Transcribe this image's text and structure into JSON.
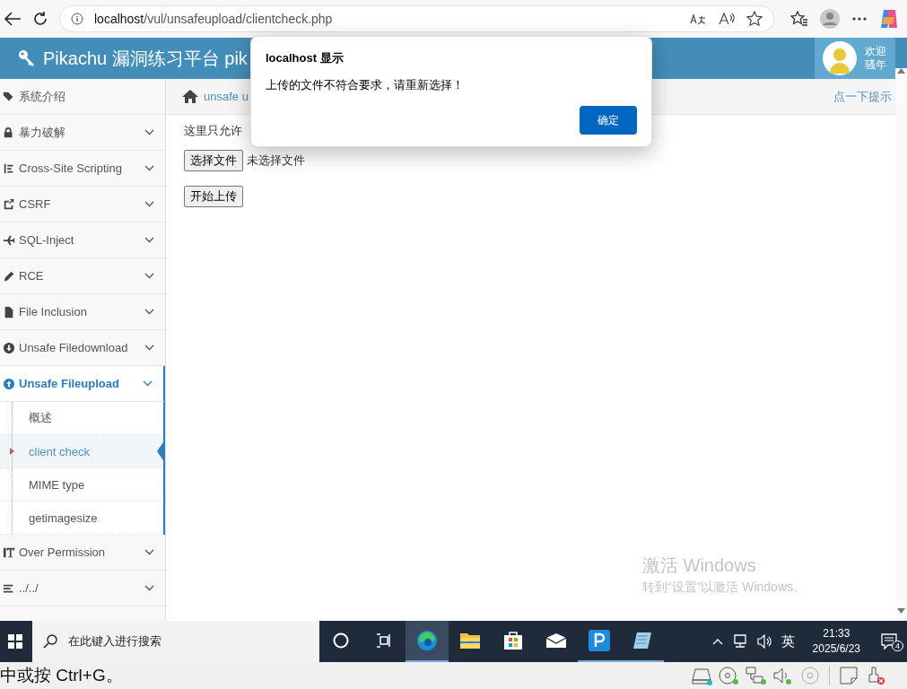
{
  "browser": {
    "url_host": "localhost",
    "url_path": "/vul/unsafeupload/clientcheck.php"
  },
  "header": {
    "title": "Pikachu 漏洞练习平台 pik",
    "welcome": [
      "欢迎",
      "骚年"
    ]
  },
  "sidebar": {
    "items": [
      {
        "label": "系统介绍",
        "kind": "link",
        "selected": false
      },
      {
        "label": "暴力破解",
        "kind": "menu",
        "selected": false,
        "expanded": false
      },
      {
        "label": "Cross-Site Scripting",
        "kind": "menu",
        "selected": false,
        "expanded": false
      },
      {
        "label": "CSRF",
        "kind": "menu",
        "selected": false,
        "expanded": false
      },
      {
        "label": "SQL-Inject",
        "kind": "menu",
        "selected": false,
        "expanded": false
      },
      {
        "label": "RCE",
        "kind": "menu",
        "selected": false,
        "expanded": false
      },
      {
        "label": "File Inclusion",
        "kind": "menu",
        "selected": false,
        "expanded": false
      },
      {
        "label": "Unsafe Filedownload",
        "kind": "menu",
        "selected": false,
        "expanded": false
      },
      {
        "label": "Unsafe Fileupload",
        "kind": "menu",
        "selected": true,
        "expanded": true,
        "children": [
          {
            "label": "概述",
            "selected": false
          },
          {
            "label": "client check",
            "selected": true
          },
          {
            "label": "MIME type",
            "selected": false
          },
          {
            "label": "getimagesize",
            "selected": false
          }
        ]
      },
      {
        "label": "Over Permission",
        "kind": "menu",
        "selected": false,
        "expanded": false
      },
      {
        "label": "../../",
        "kind": "menu",
        "selected": false,
        "expanded": false
      }
    ]
  },
  "breadcrumb": {
    "link": "unsafe u",
    "hint": "点一下提示"
  },
  "content": {
    "intro": "这里只允许",
    "file_button": "选择文件",
    "file_status": "未选择文件",
    "upload_button": "开始上传"
  },
  "dialog": {
    "title": "localhost 显示",
    "message": "上传的文件不符合要求，请重新选择！",
    "ok": "确定"
  },
  "watermark": {
    "title": "激活 Windows",
    "subtitle": "转到“设置”以激活 Windows。"
  },
  "taskbar": {
    "search_placeholder": "在此键入进行搜索",
    "apps": [
      {
        "kind": "cortana",
        "selected": false,
        "running": false
      },
      {
        "kind": "taskview",
        "selected": false,
        "running": false
      },
      {
        "kind": "edge",
        "selected": true,
        "running": true
      },
      {
        "kind": "folder",
        "selected": false,
        "running": false
      },
      {
        "kind": "store",
        "selected": false,
        "running": false
      },
      {
        "kind": "mail",
        "selected": false,
        "running": false
      },
      {
        "kind": "papp",
        "selected": false,
        "running": true
      },
      {
        "kind": "notepad",
        "selected": false,
        "running": true
      }
    ],
    "ime": "英",
    "time": "21:33",
    "date": "2025/6/23",
    "notifications": "4"
  },
  "vm_bar": {
    "message": "中或按 Ctrl+G。"
  }
}
